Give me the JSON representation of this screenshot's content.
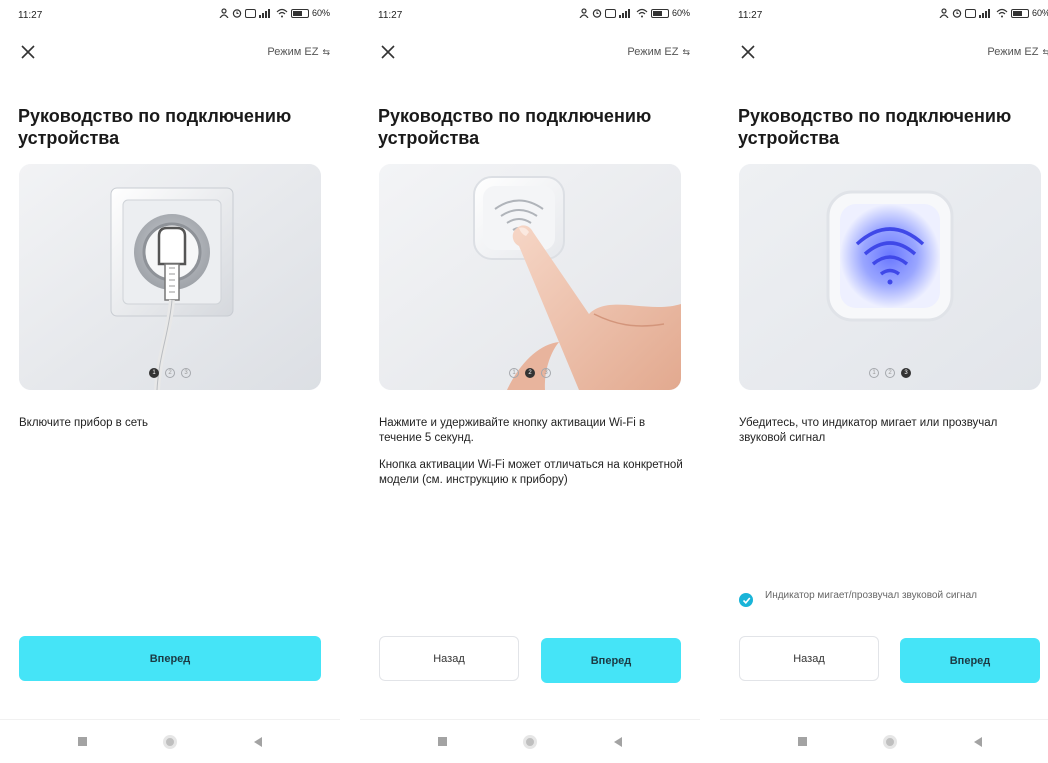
{
  "status_bar": {
    "time": "11:27",
    "battery": "60%"
  },
  "header": {
    "ez_mode": "Режим EZ",
    "title": "Руководство по подключению устройства"
  },
  "screens": [
    {
      "step_active": 1,
      "image": "plug-in-socket",
      "description": [
        "Включите прибор в сеть"
      ],
      "buttons": {
        "next": "Вперед"
      }
    },
    {
      "step_active": 2,
      "image": "press-wifi-button",
      "description": [
        "Нажмите и удерживайте кнопку активации Wi-Fi в течение 5 секунд.",
        "Кнопка активации Wi-Fi может отличаться на конкретной модели (см. инструкцию к прибору)"
      ],
      "buttons": {
        "back": "Назад",
        "next": "Вперед"
      }
    },
    {
      "step_active": 3,
      "image": "wifi-indicator-glowing",
      "description": [
        "Убедитесь, что индикатор мигает или прозвучал звуковой сигнал"
      ],
      "confirm_checkbox": {
        "label": "Индикатор мигает/прозвучал звуковой сигнал",
        "checked": true
      },
      "buttons": {
        "back": "Назад",
        "next": "Вперед"
      }
    }
  ],
  "step_labels": [
    "1",
    "2",
    "3"
  ],
  "colors": {
    "primary": "#45e4f7",
    "check": "#19b4d8"
  }
}
